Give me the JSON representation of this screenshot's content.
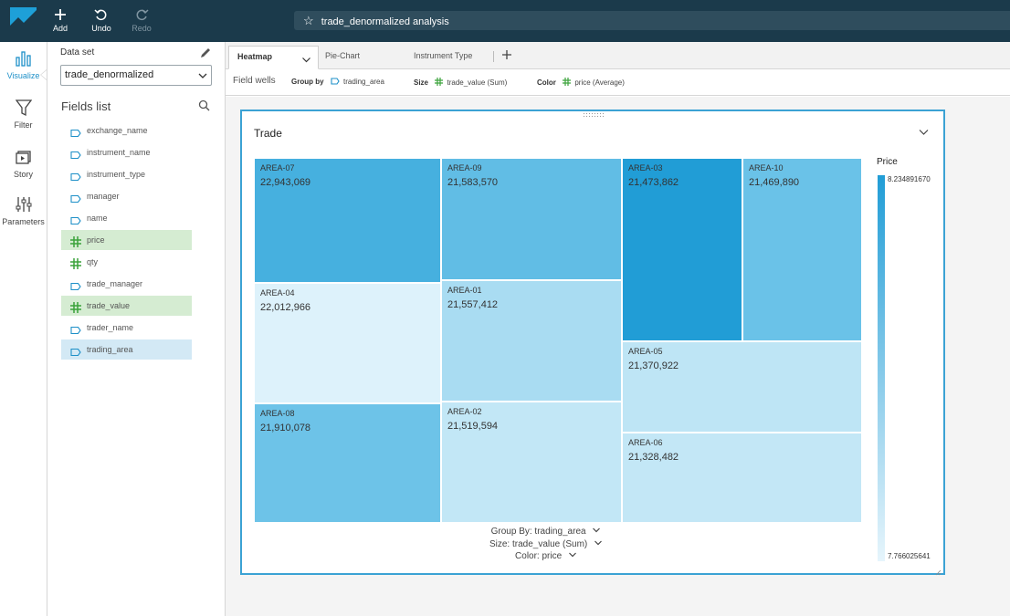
{
  "toolbar": {
    "add_label": "Add",
    "undo_label": "Undo",
    "redo_label": "Redo",
    "analysis_title": "trade_denormalized analysis",
    "brand_color": "#1ea0d8",
    "bar_color": "#1b3a4b"
  },
  "rail": {
    "visualize": "Visualize",
    "filter": "Filter",
    "story": "Story",
    "parameters": "Parameters"
  },
  "panel": {
    "dataset_label": "Data set",
    "dataset_value": "trade_denormalized",
    "fields_title": "Fields list",
    "fields": [
      {
        "name": "exchange_name",
        "kind": "dimension",
        "state": "none"
      },
      {
        "name": "instrument_name",
        "kind": "dimension",
        "state": "none"
      },
      {
        "name": "instrument_type",
        "kind": "dimension",
        "state": "none"
      },
      {
        "name": "manager",
        "kind": "dimension",
        "state": "none"
      },
      {
        "name": "name",
        "kind": "dimension",
        "state": "none"
      },
      {
        "name": "price",
        "kind": "measure",
        "state": "selected"
      },
      {
        "name": "qty",
        "kind": "measure",
        "state": "none"
      },
      {
        "name": "trade_manager",
        "kind": "dimension",
        "state": "none"
      },
      {
        "name": "trade_value",
        "kind": "measure",
        "state": "selected"
      },
      {
        "name": "trader_name",
        "kind": "dimension",
        "state": "none"
      },
      {
        "name": "trading_area",
        "kind": "dimension",
        "state": "selected"
      }
    ]
  },
  "tabs": [
    {
      "label": "Heatmap",
      "active": true
    },
    {
      "label": "Pie-Chart",
      "active": false
    },
    {
      "label": "Instrument Type",
      "active": false
    }
  ],
  "wells": {
    "label": "Field wells",
    "group_by_title": "Group by",
    "group_by_value": "trading_area",
    "size_title": "Size",
    "size_value": "trade_value (Sum)",
    "color_title": "Color",
    "color_value": "price (Average)"
  },
  "visual": {
    "title": "Trade",
    "group_by_axis": "Group By: trading_area",
    "size_axis": "Size: trade_value (Sum)",
    "color_axis": "Color: price",
    "legend_title": "Price",
    "legend_max": "8.234891670",
    "legend_min": "7.766025641"
  },
  "chart_data": {
    "type": "heatmap",
    "title": "Trade",
    "group_by": "trading_area",
    "size_field": "trade_value (Sum)",
    "color_field": "price",
    "color_range": [
      7.766025641,
      8.23489167
    ],
    "cells": [
      {
        "name": "AREA-07",
        "value": 22943069,
        "color": 0.7,
        "color_hex": "#46b0df"
      },
      {
        "name": "AREA-04",
        "value": 22012966,
        "color": 0.05,
        "color_hex": "#ddf2fb"
      },
      {
        "name": "AREA-08",
        "value": 21910078,
        "color": 0.58,
        "color_hex": "#6dc3e8"
      },
      {
        "name": "AREA-09",
        "value": 21583570,
        "color": 0.55,
        "color_hex": "#61bde5"
      },
      {
        "name": "AREA-01",
        "value": 21557412,
        "color": 0.3,
        "color_hex": "#a9dcf2"
      },
      {
        "name": "AREA-02",
        "value": 21519594,
        "color": 0.2,
        "color_hex": "#c2e7f6"
      },
      {
        "name": "AREA-03",
        "value": 21473862,
        "color": 0.9,
        "color_hex": "#219dd6"
      },
      {
        "name": "AREA-10",
        "value": 21469890,
        "color": 0.55,
        "color_hex": "#6ac2e8"
      },
      {
        "name": "AREA-05",
        "value": 21370922,
        "color": 0.2,
        "color_hex": "#bee5f5"
      },
      {
        "name": "AREA-06",
        "value": 21328482,
        "color": 0.18,
        "color_hex": "#c3e7f6"
      }
    ]
  }
}
